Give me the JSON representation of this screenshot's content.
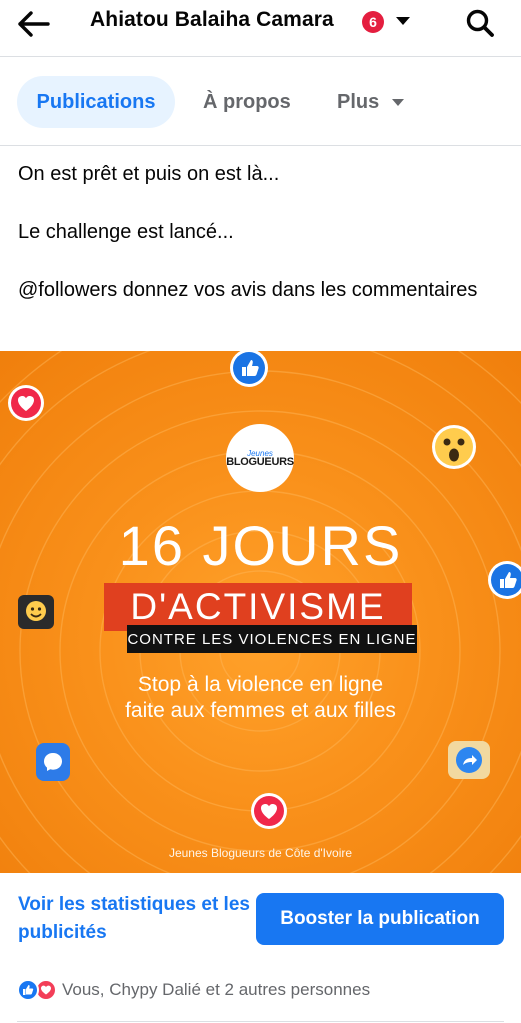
{
  "header": {
    "title": "Ahiatou Balaiha Camara",
    "badge_count": "6",
    "back_icon": "arrow-left-icon",
    "search_icon": "search-icon"
  },
  "tabs": [
    {
      "label": "Publications",
      "active": true
    },
    {
      "label": "À propos",
      "active": false
    },
    {
      "label": "Plus",
      "active": false
    }
  ],
  "post": {
    "lines": [
      "On est prêt et puis on est là...",
      "Le challenge est lancé...",
      "@followers donnez vos avis dans les commentaires"
    ],
    "image": {
      "logo_script": "Jeunes",
      "logo_text": "BLOGUEURS",
      "headline": "16 JOURS",
      "activism": "D'ACTIVISME",
      "subtitle": "CONTRE LES VIOLENCES EN LIGNE",
      "stop_line1": "Stop à la violence en ligne",
      "stop_line2": "faite aux femmes et aux filles",
      "credit": "Jeunes Blogueurs de Côte d'Ivoire",
      "background_color": "#f7901a"
    }
  },
  "actions": {
    "stats_link": "Voir les statistiques et les publicités",
    "boost_button": "Booster la publication"
  },
  "reactions": {
    "summary": "Vous, Chypy Dalié et 2 autres personnes",
    "types": [
      "like",
      "love"
    ]
  },
  "colors": {
    "accent": "#1877f2",
    "badge": "#e41e3f",
    "love": "#f33e58"
  }
}
